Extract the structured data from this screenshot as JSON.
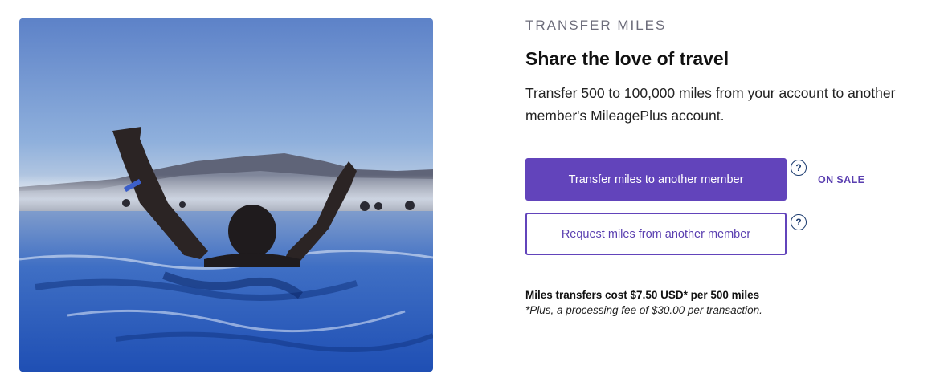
{
  "hero": {
    "image_description_icon": "photo-swimmer-lagoon"
  },
  "section": {
    "eyebrow": "TRANSFER MILES",
    "title": "Share the love of travel",
    "description": "Transfer 500 to 100,000 miles from your account to another member's MileagePlus account."
  },
  "actions": {
    "transfer_label": "Transfer miles to another member",
    "request_label": "Request miles from another member",
    "help_glyph": "?",
    "sale_badge": "ON SALE"
  },
  "pricing": {
    "cost_line": "Miles transfers cost $7.50 USD* per 500 miles",
    "fee_note": "*Plus, a processing fee of $30.00 per transaction."
  },
  "colors": {
    "brand_purple": "#6244bb",
    "help_navy": "#1a3a6e"
  }
}
